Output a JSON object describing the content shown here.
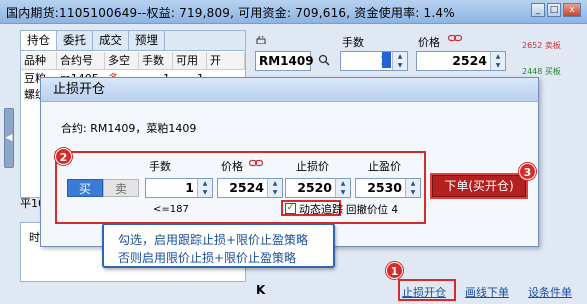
{
  "title": "国内期货:1105100649--权益: 719,809, 可用资金: 709,616, 资金使用率: 1.4%",
  "window_controls": {
    "minimize": "_",
    "maximize": "□",
    "close": "x"
  },
  "positions": {
    "tabs": [
      "持仓",
      "委托",
      "成交",
      "预埋"
    ],
    "active_tab": 0,
    "columns": [
      "品种",
      "合约号",
      "多空",
      "手数",
      "可用",
      "开"
    ],
    "rows": [
      {
        "name": "豆粕",
        "contract": "m1405",
        "side": "多",
        "qty": "1",
        "avail": "1"
      },
      {
        "name": "螺纹",
        "contract": "",
        "side": "",
        "qty": "",
        "avail": ""
      }
    ]
  },
  "order_panel": {
    "contract": "RM1409",
    "qty_label": "手数",
    "price_label": "价格",
    "qty": "1",
    "price": "2524",
    "sell_side_qty": "2652 卖板",
    "buy_side_qty": "2448 买板"
  },
  "dialog": {
    "title": "止损开仓",
    "contract_label": "合约:",
    "contract_value": "RM1409，菜粕1409",
    "buy_label": "买",
    "sell_label": "卖",
    "qty_label": "手数",
    "price_label": "价格",
    "stop_label": "止损价",
    "profit_label": "止盈价",
    "qty": "1",
    "price": "2524",
    "stop_price": "2520",
    "profit_price": "2530",
    "max_qty": "<=187",
    "trailing_label": "动态追踪",
    "trailing_checked": true,
    "pullback_label": "回撤价位",
    "pullback_value": "4",
    "order_button": "下单(买开仓)"
  },
  "badges": {
    "one": "1",
    "two": "2",
    "three": "3"
  },
  "tooltip": {
    "line1": "勾选，启用跟踪止损+限价止盈策略",
    "line2": "否则启用限价止损+限价止盈策略"
  },
  "lower_panel": {
    "ping_label": "平100",
    "time_header": "时间"
  },
  "bottom_bar": {
    "k_label": "K",
    "stop_open": "止损开仓",
    "draw_order": "画线下单",
    "conditional_order": "设条件单"
  },
  "colors": {
    "accent_red": "#d62b2b",
    "buy_blue": "#3a7bd5",
    "link_blue": "#1a4fa0"
  }
}
